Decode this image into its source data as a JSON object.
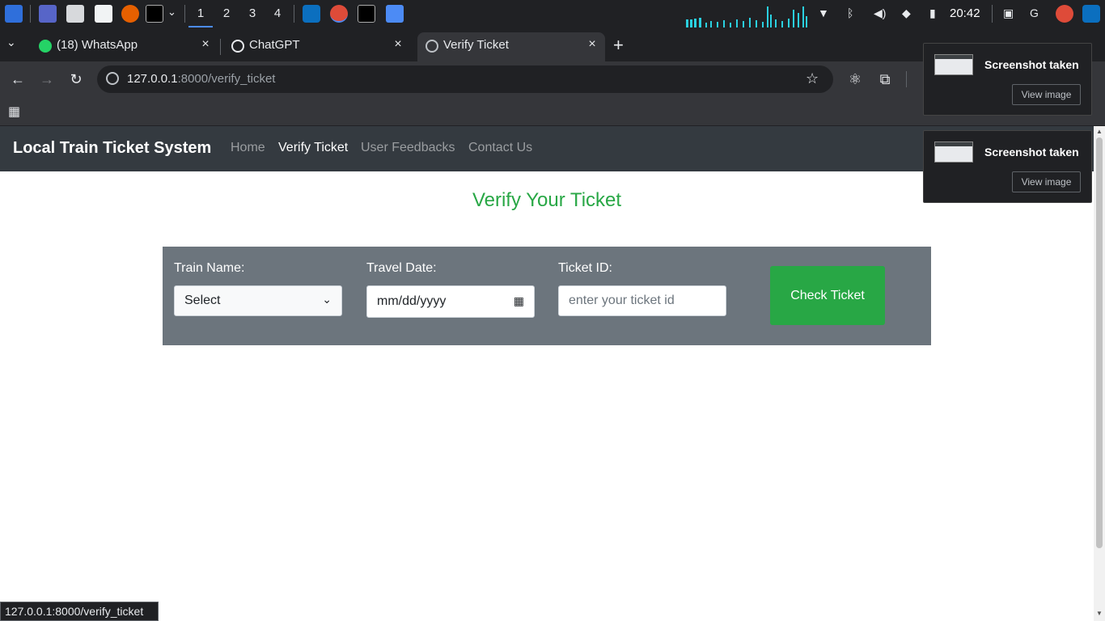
{
  "taskbar": {
    "workspaces": [
      "1",
      "2",
      "3",
      "4"
    ],
    "clock": "20:42"
  },
  "browser": {
    "tabs": [
      {
        "label": "(18) WhatsApp",
        "badge": "18"
      },
      {
        "label": "ChatGPT"
      },
      {
        "label": "Verify Ticket"
      }
    ],
    "new_tab_icon": "plus-icon",
    "address": {
      "host": "127.0.0.1",
      "path": ":8000/verify_ticket"
    },
    "status_url": "127.0.0.1:8000/verify_ticket"
  },
  "site": {
    "brand": "Local Train Ticket System",
    "nav": [
      "Home",
      "Verify Ticket",
      "User Feedbacks",
      "Contact Us"
    ],
    "active_nav": "Verify Ticket",
    "heading": "Verify Your Ticket",
    "form": {
      "train_label": "Train Name:",
      "train_selected": "Select",
      "date_label": "Travel Date:",
      "date_placeholder": "mm/dd/yyyy",
      "ticket_label": "Ticket ID:",
      "ticket_placeholder": "enter your ticket id",
      "submit": "Check Ticket"
    }
  },
  "notifications": [
    {
      "title": "Screenshot taken",
      "action": "View image"
    },
    {
      "title": "Screenshot taken",
      "action": "View image"
    }
  ],
  "colors": {
    "navbar": "#343a40",
    "accent_green": "#28a745",
    "form_bg": "#6c757d"
  }
}
